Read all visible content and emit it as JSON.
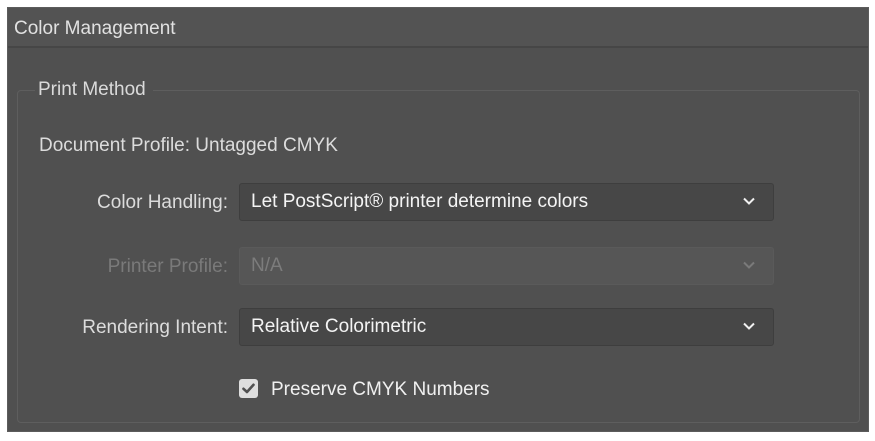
{
  "section": {
    "title": "Color Management"
  },
  "print_method": {
    "legend": "Print Method",
    "document_profile": "Document Profile: Untagged CMYK",
    "color_handling": {
      "label": "Color Handling:",
      "value": "Let PostScript® printer determine colors",
      "enabled": true
    },
    "printer_profile": {
      "label": "Printer Profile:",
      "value": "N/A",
      "enabled": false
    },
    "rendering_intent": {
      "label": "Rendering Intent:",
      "value": "Relative Colorimetric",
      "enabled": true
    },
    "preserve_cmyk": {
      "label": "Preserve CMYK Numbers",
      "checked": true
    }
  },
  "icons": {
    "dropdown": "chevron-down-icon",
    "check": "checkmark-icon"
  },
  "colors": {
    "panel_background": "#505050",
    "header_background": "#535353",
    "field_background": "#474747",
    "disabled_text": "#7a7a7a",
    "text": "#dcdcdc"
  }
}
